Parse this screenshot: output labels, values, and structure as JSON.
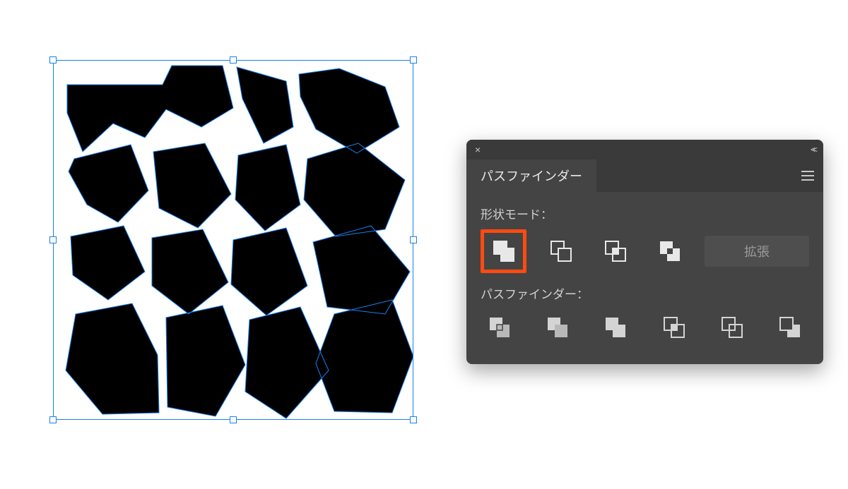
{
  "panel": {
    "tab_title": "パスファインダー",
    "shape_modes_label": "形状モード：",
    "pathfinder_label": "パスファインダー：",
    "expand_button": "拡張",
    "shape_mode_icons": [
      "unite",
      "minus-front",
      "intersect",
      "exclude"
    ],
    "pathfinder_icons": [
      "divide",
      "trim",
      "merge",
      "crop",
      "outline",
      "minus-back"
    ],
    "highlighted_shape_mode": "unite"
  },
  "colors": {
    "panel_bg": "#444444",
    "panel_bg_dark": "#3a3a3a",
    "highlight": "#ff4a11",
    "selection": "#1a7ff0"
  }
}
